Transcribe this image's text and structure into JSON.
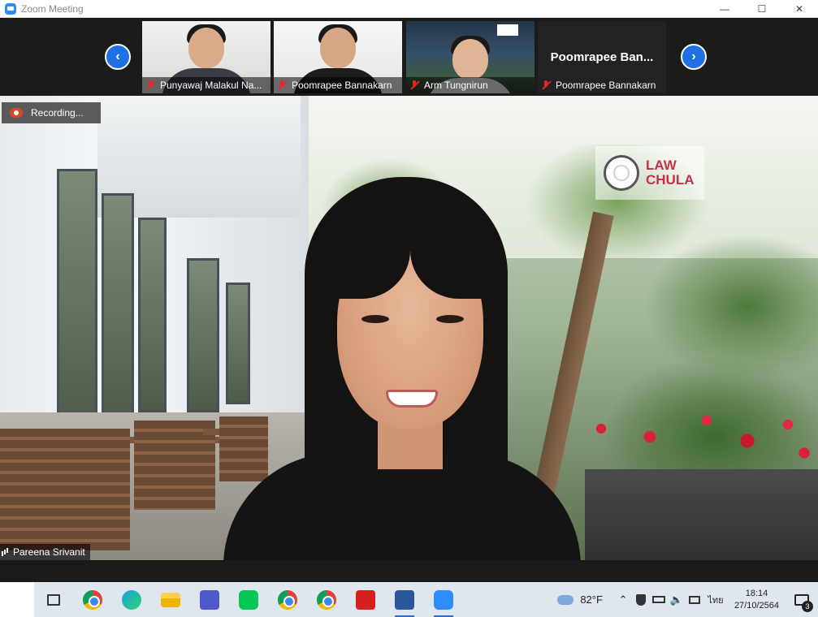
{
  "window": {
    "title": "Zoom Meeting",
    "minimize_glyph": "—",
    "maximize_glyph": "☐",
    "close_glyph": "✕"
  },
  "gallery": {
    "prev_glyph": "‹",
    "next_glyph": "›",
    "tiles": [
      {
        "name": "Punyawaj Malakul Na..."
      },
      {
        "name": "Poomrapee Bannakarn"
      },
      {
        "name": "Arm Tungnirun"
      },
      {
        "name": "Poomrapee Bannakarn",
        "big_name": "Poomrapee  Ban..."
      }
    ]
  },
  "recording": {
    "label": "Recording..."
  },
  "main_video": {
    "speaker_name": "Pareena Srivanit",
    "logo_line1": "LAW",
    "logo_line2": "CHULA"
  },
  "taskbar": {
    "weather_temp": "82°F",
    "tray_glyphs": {
      "chevron": "⌃",
      "volume": "🔈",
      "lang": "ไทย"
    },
    "time": "18:14",
    "date": "27/10/2564",
    "notification_count": "3"
  },
  "colors": {
    "zoom_blue": "#1f6fe5",
    "muted_red": "#e22222",
    "law_chula_red": "#c9304a"
  }
}
